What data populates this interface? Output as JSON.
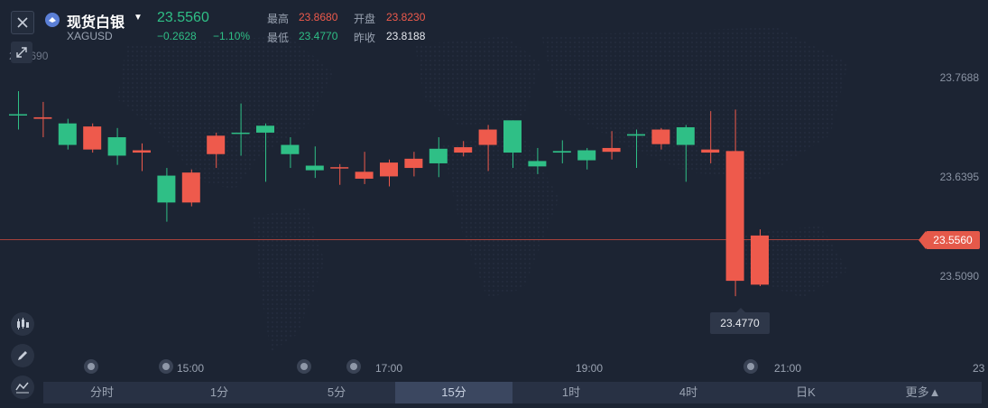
{
  "header": {
    "name": "现货白银",
    "code": "XAGUSD",
    "last_price": "23.5560",
    "change": "−0.2628",
    "change_pct": "−1.10%",
    "stats": {
      "high_label": "最高",
      "high_value": "23.8680",
      "open_label": "开盘",
      "open_value": "23.8230",
      "low_label": "最低",
      "low_value": "23.4770",
      "prev_close_label": "昨收",
      "prev_close_value": "23.8188"
    },
    "ghost_axis_label": "23.7690"
  },
  "chart_data": {
    "type": "candlestick",
    "interval": "15分",
    "up_color": "#2fbf86",
    "down_color": "#ee5a4c",
    "y_ticks": [
      "23.7688",
      "23.6395",
      "23.5090"
    ],
    "x_ticks": [
      "15:00",
      "17:00",
      "19:00",
      "21:00",
      "23"
    ],
    "current_price": "23.5560",
    "low_marker": "23.4770",
    "candles": [
      {
        "o": 23.72,
        "c": 23.72,
        "h": 23.75,
        "l": 23.7
      },
      {
        "o": 23.716,
        "c": 23.714,
        "h": 23.736,
        "l": 23.69
      },
      {
        "o": 23.68,
        "c": 23.708,
        "h": 23.714,
        "l": 23.674
      },
      {
        "o": 23.704,
        "c": 23.674,
        "h": 23.708,
        "l": 23.67
      },
      {
        "o": 23.666,
        "c": 23.69,
        "h": 23.702,
        "l": 23.654
      },
      {
        "o": 23.673,
        "c": 23.67,
        "h": 23.682,
        "l": 23.646
      },
      {
        "o": 23.605,
        "c": 23.64,
        "h": 23.65,
        "l": 23.58
      },
      {
        "o": 23.644,
        "c": 23.605,
        "h": 23.648,
        "l": 23.6
      },
      {
        "o": 23.692,
        "c": 23.668,
        "h": 23.696,
        "l": 23.65
      },
      {
        "o": 23.696,
        "c": 23.696,
        "h": 23.734,
        "l": 23.666
      },
      {
        "o": 23.696,
        "c": 23.705,
        "h": 23.708,
        "l": 23.632
      },
      {
        "o": 23.668,
        "c": 23.68,
        "h": 23.69,
        "l": 23.65
      },
      {
        "o": 23.647,
        "c": 23.653,
        "h": 23.678,
        "l": 23.637
      },
      {
        "o": 23.651,
        "c": 23.65,
        "h": 23.655,
        "l": 23.628
      },
      {
        "o": 23.645,
        "c": 23.636,
        "h": 23.671,
        "l": 23.629
      },
      {
        "o": 23.657,
        "c": 23.639,
        "h": 23.661,
        "l": 23.626
      },
      {
        "o": 23.662,
        "c": 23.65,
        "h": 23.671,
        "l": 23.639
      },
      {
        "o": 23.656,
        "c": 23.675,
        "h": 23.69,
        "l": 23.638
      },
      {
        "o": 23.677,
        "c": 23.67,
        "h": 23.685,
        "l": 23.665
      },
      {
        "o": 23.7,
        "c": 23.68,
        "h": 23.706,
        "l": 23.646
      },
      {
        "o": 23.67,
        "c": 23.712,
        "h": 23.712,
        "l": 23.65
      },
      {
        "o": 23.652,
        "c": 23.659,
        "h": 23.676,
        "l": 23.642
      },
      {
        "o": 23.67,
        "c": 23.672,
        "h": 23.686,
        "l": 23.656
      },
      {
        "o": 23.66,
        "c": 23.673,
        "h": 23.676,
        "l": 23.648
      },
      {
        "o": 23.676,
        "c": 23.671,
        "h": 23.698,
        "l": 23.661
      },
      {
        "o": 23.692,
        "c": 23.694,
        "h": 23.7,
        "l": 23.65
      },
      {
        "o": 23.7,
        "c": 23.681,
        "h": 23.702,
        "l": 23.674
      },
      {
        "o": 23.68,
        "c": 23.703,
        "h": 23.706,
        "l": 23.632
      },
      {
        "o": 23.674,
        "c": 23.67,
        "h": 23.724,
        "l": 23.656
      },
      {
        "o": 23.672,
        "c": 23.503,
        "h": 23.726,
        "l": 23.483
      },
      {
        "o": 23.562,
        "c": 23.498,
        "h": 23.57,
        "l": 23.496
      }
    ]
  },
  "tools": [
    "candlestick-tool-icon",
    "pencil-icon",
    "line-chart-icon"
  ],
  "periods": [
    "分时",
    "1分",
    "5分",
    "15分",
    "1时",
    "4时",
    "日K",
    "更多▲"
  ],
  "active_period_index": 3
}
